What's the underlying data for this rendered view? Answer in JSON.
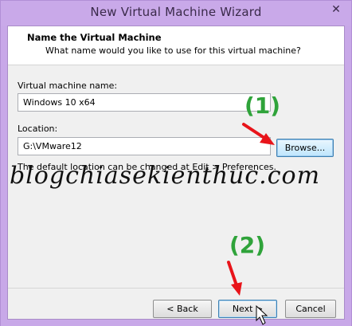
{
  "window": {
    "title": "New Virtual Machine Wizard",
    "close_label": "✕"
  },
  "header": {
    "title": "Name the Virtual Machine",
    "subtitle": "What name would you like to use for this virtual machine?"
  },
  "form": {
    "vm_name_label": "Virtual machine name:",
    "vm_name_value": "Windows 10 x64",
    "location_label": "Location:",
    "location_value": "G:\\VMware12",
    "browse_label": "Browse...",
    "hint": "The default location can be changed at Edit > Preferences."
  },
  "watermark": "blogchiasekienthuc.com",
  "annotations": {
    "one": "(1)",
    "two": "(2)",
    "arrow_color": "#e8141a",
    "label_color": "#2fa33a"
  },
  "footer": {
    "back_label": "< Back",
    "next_label": "Next >",
    "cancel_label": "Cancel"
  },
  "colors": {
    "title_bar": "#c9a9e9",
    "dialog_bg": "#f0f0f0"
  }
}
